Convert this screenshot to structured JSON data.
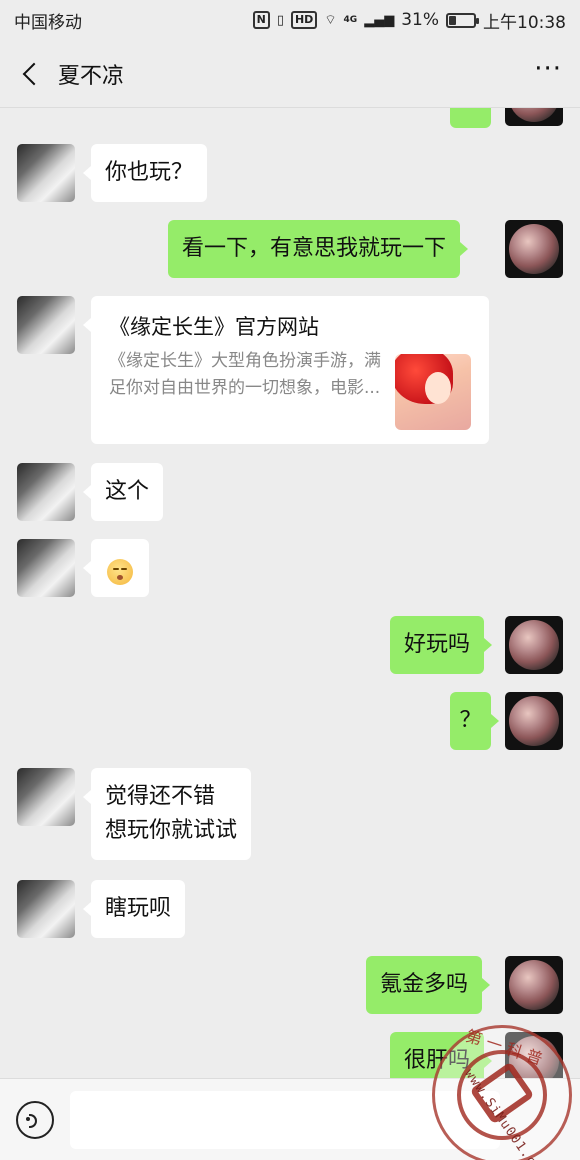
{
  "status_bar": {
    "carrier": "中国移动",
    "nfc": "N",
    "hd": "HD",
    "network": "4G",
    "battery_percent": "31%",
    "battery_level": 0.31,
    "time": "上午10:38"
  },
  "header": {
    "title": "夏不凉",
    "more": "···"
  },
  "messages": [
    {
      "side": "left",
      "text": "你也玩？"
    },
    {
      "side": "right",
      "text": "看一下，有意思我就玩一下"
    },
    {
      "side": "left",
      "type": "link_card",
      "card_title": "《缘定长生》官方网站",
      "card_desc": "《缘定长生》大型角色扮演手游，满足你对自由世界的一切想象，电影..."
    },
    {
      "side": "left",
      "text": "这个"
    },
    {
      "side": "left",
      "type": "emoji",
      "emoji": "pensive-face-icon"
    },
    {
      "side": "right",
      "text": "好玩吗"
    },
    {
      "side": "right",
      "text": "？"
    },
    {
      "side": "left",
      "text_lines": [
        "觉得还不错",
        "想玩你就试试"
      ]
    },
    {
      "side": "left",
      "text": "瞎玩呗"
    },
    {
      "side": "right",
      "text": "氪金多吗"
    },
    {
      "side": "right",
      "text": "很肝吗"
    }
  ],
  "watermark": {
    "top_text": "第 一 科 普",
    "url_text": "www.SiMu001.cn"
  },
  "colors": {
    "background": "#ededed",
    "sent_bubble": "#95ec69",
    "received_bubble": "#ffffff"
  }
}
